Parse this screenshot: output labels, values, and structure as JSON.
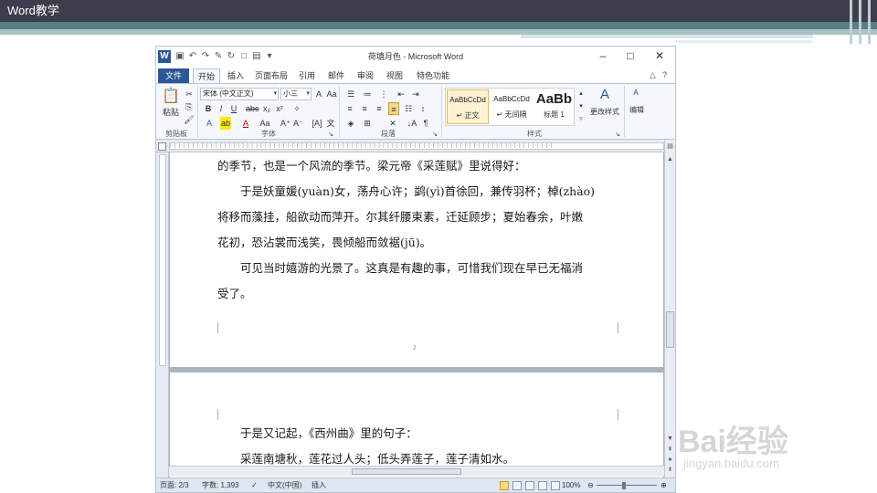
{
  "slide": {
    "title": "Word教学"
  },
  "window": {
    "title": "荷塘月色 - Microsoft Word",
    "app_icon": "W",
    "quick_access": [
      "save-icon",
      "undo-icon",
      "redo-icon",
      "customize-icon"
    ]
  },
  "tabs": [
    {
      "label": "文件"
    },
    {
      "label": "开始"
    },
    {
      "label": "插入"
    },
    {
      "label": "页面布局"
    },
    {
      "label": "引用"
    },
    {
      "label": "邮件"
    },
    {
      "label": "审阅"
    },
    {
      "label": "视图"
    },
    {
      "label": "特色功能"
    }
  ],
  "ribbon": {
    "clipboard": {
      "paste_label": "粘贴",
      "group_label": "剪贴板"
    },
    "font": {
      "font_name": "宋体 (中文正文)",
      "font_size": "小三",
      "group_label": "字体"
    },
    "paragraph": {
      "group_label": "段落"
    },
    "styles": {
      "group_label": "样式",
      "items": [
        {
          "sample": "AaBbCcDd",
          "name": "↵ 正文"
        },
        {
          "sample": "AaBbCcDd",
          "name": "↵ 无间隔"
        },
        {
          "sample": "AaBb",
          "name": "标题 1"
        }
      ],
      "change_styles_label": "更改样式"
    },
    "editing": {
      "label": "编辑"
    }
  },
  "document": {
    "page1_lines": [
      "的季节，也是一个风流的季节。梁元帝《采莲赋》里说得好：",
      "　　于是妖童媛(yuàn)女，荡舟心许；鹢(yì)首徐回，兼传羽杯；棹(zhào)",
      "将移而藻挂，船欲动而萍开。尔其纤腰束素，迁延顾步；夏始春余，叶嫩",
      "花初，恐沾裳而浅笑，畏倾船而敛裾(jū)。",
      "　　可见当时嬉游的光景了。这真是有趣的事，可惜我们现在早已无福消",
      "受了。"
    ],
    "page_number": "2",
    "page2_lines": [
      "　　于是又记起，《西州曲》里的句子：",
      "　　采莲南塘秋，莲花过人头；低头弄莲子，莲子清如水。"
    ]
  },
  "status": {
    "page": "页面: 2/3",
    "words": "字数: 1,393",
    "language": "中文(中国)",
    "mode": "插入",
    "zoom": "100%",
    "zoom_fraction": 0.5
  },
  "watermark": {
    "logo": "Bai经验",
    "url": "jingyan.baidu.com"
  }
}
